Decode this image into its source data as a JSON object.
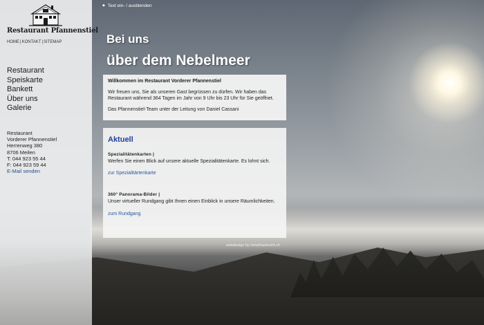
{
  "toggle": {
    "label": "Text ein- / ausblenden"
  },
  "sidebar": {
    "logo_text": "Restaurant Pfannenstiel",
    "toplinks": [
      "HOME",
      "KONTAKT",
      "SITEMAP"
    ],
    "nav": [
      "Restaurant",
      "Speiskarte",
      "Bankett",
      "Über uns",
      "Galerie"
    ],
    "address": {
      "line1": "Restaurant",
      "line2": "Vorderer Pfannenstiel",
      "line3": "Herrenweg 380",
      "line4": "8706 Meilen",
      "phone": "T: 044 923 55 44",
      "fax": "F: 044 923 59 44",
      "email_link": "E-Mail senden"
    }
  },
  "hero": {
    "line1": "Bei uns",
    "line2": "über dem Nebelmeer"
  },
  "welcome": {
    "title": "Willkommen im Restaurant Vorderer Pfannenstiel",
    "p1": "Wir freuen uns, Sie als unseren Gast begrüssen zu dürfen. Wir haben das Restaurant während 364 Tagen im Jahr von 9 Uhr bis 23 Uhr für Sie geöffnet.",
    "p2": "Das Pfannenstiel-Team unter der Leitung von Daniel Cassani"
  },
  "aktuell": {
    "heading": "Aktuell",
    "items": [
      {
        "title": "Spezialitätenkarten |",
        "text": "Werfen Sie einen Blick auf unsere aktuelle Spezialitätenkarte. Es lohnt sich.",
        "link": "zur Spezialitärtenkarte"
      },
      {
        "title": "360° Panorama-Bilder |",
        "text": "Unser virtueller Rundgang gibt Ihnen einen Einblick in unsere Räumlichkeiten.",
        "link": "zum Rundgang"
      }
    ]
  },
  "credit": "webdesign by HotelGastro24.ch",
  "colors": {
    "heading_blue": "#1f3f9a",
    "link_blue": "#2a58a0"
  }
}
